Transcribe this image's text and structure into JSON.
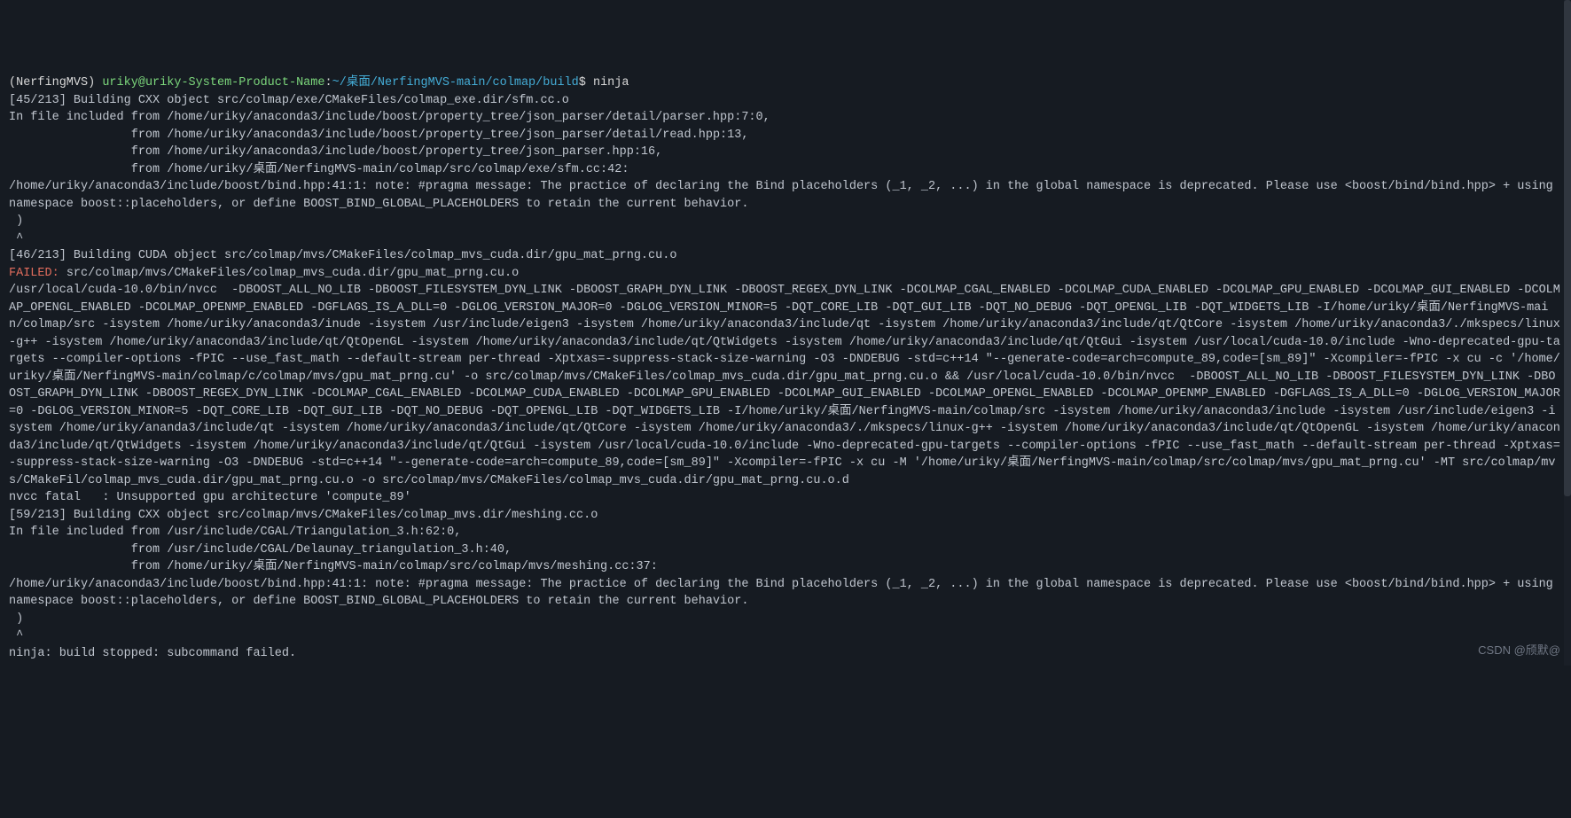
{
  "prompt": {
    "env": "(NerfingMVS)",
    "user": "uriky",
    "at": "@",
    "host": "uriky-System-Product-Name",
    "colon": ":",
    "tilde": "~",
    "path": "/桌面/NerfingMVS-main/colmap/build",
    "dollar": "$",
    "command": "ninja"
  },
  "lines": {
    "l01": "[45/213] Building CXX object src/colmap/exe/CMakeFiles/colmap_exe.dir/sfm.cc.o",
    "l02": "In file included from /home/uriky/anaconda3/include/boost/property_tree/json_parser/detail/parser.hpp:7:0,",
    "l03": "                 from /home/uriky/anaconda3/include/boost/property_tree/json_parser/detail/read.hpp:13,",
    "l04": "                 from /home/uriky/anaconda3/include/boost/property_tree/json_parser.hpp:16,",
    "l05": "                 from /home/uriky/桌面/NerfingMVS-main/colmap/src/colmap/exe/sfm.cc:42:",
    "l06": "/home/uriky/anaconda3/include/boost/bind.hpp:41:1: note: #pragma message: The practice of declaring the Bind placeholders (_1, _2, ...) in the global namespace is deprecated. Please use <boost/bind/bind.hpp> + using namespace boost::placeholders, or define BOOST_BIND_GLOBAL_PLACEHOLDERS to retain the current behavior.",
    "l07": " )",
    "l08": " ^",
    "l09": "[46/213] Building CUDA object src/colmap/mvs/CMakeFiles/colmap_mvs_cuda.dir/gpu_mat_prng.cu.o",
    "fail_label": "FAILED: ",
    "fail_rest": "src/colmap/mvs/CMakeFiles/colmap_mvs_cuda.dir/gpu_mat_prng.cu.o",
    "l11": "/usr/local/cuda-10.0/bin/nvcc  -DBOOST_ALL_NO_LIB -DBOOST_FILESYSTEM_DYN_LINK -DBOOST_GRAPH_DYN_LINK -DBOOST_REGEX_DYN_LINK -DCOLMAP_CGAL_ENABLED -DCOLMAP_CUDA_ENABLED -DCOLMAP_GPU_ENABLED -DCOLMAP_GUI_ENABLED -DCOLMAP_OPENGL_ENABLED -DCOLMAP_OPENMP_ENABLED -DGFLAGS_IS_A_DLL=0 -DGLOG_VERSION_MAJOR=0 -DGLOG_VERSION_MINOR=5 -DQT_CORE_LIB -DQT_GUI_LIB -DQT_NO_DEBUG -DQT_OPENGL_LIB -DQT_WIDGETS_LIB -I/home/uriky/桌面/NerfingMVS-main/colmap/src -isystem /home/uriky/anaconda3/inude -isystem /usr/include/eigen3 -isystem /home/uriky/anaconda3/include/qt -isystem /home/uriky/anaconda3/include/qt/QtCore -isystem /home/uriky/anaconda3/./mkspecs/linux-g++ -isystem /home/uriky/anaconda3/include/qt/QtOpenGL -isystem /home/uriky/anaconda3/include/qt/QtWidgets -isystem /home/uriky/anaconda3/include/qt/QtGui -isystem /usr/local/cuda-10.0/include -Wno-deprecated-gpu-targets --compiler-options -fPIC --use_fast_math --default-stream per-thread -Xptxas=-suppress-stack-size-warning -O3 -DNDEBUG -std=c++14 \"--generate-code=arch=compute_89,code=[sm_89]\" -Xcompiler=-fPIC -x cu -c '/home/uriky/桌面/NerfingMVS-main/colmap/c/colmap/mvs/gpu_mat_prng.cu' -o src/colmap/mvs/CMakeFiles/colmap_mvs_cuda.dir/gpu_mat_prng.cu.o && /usr/local/cuda-10.0/bin/nvcc  -DBOOST_ALL_NO_LIB -DBOOST_FILESYSTEM_DYN_LINK -DBOOST_GRAPH_DYN_LINK -DBOOST_REGEX_DYN_LINK -DCOLMAP_CGAL_ENABLED -DCOLMAP_CUDA_ENABLED -DCOLMAP_GPU_ENABLED -DCOLMAP_GUI_ENABLED -DCOLMAP_OPENGL_ENABLED -DCOLMAP_OPENMP_ENABLED -DGFLAGS_IS_A_DLL=0 -DGLOG_VERSION_MAJOR=0 -DGLOG_VERSION_MINOR=5 -DQT_CORE_LIB -DQT_GUI_LIB -DQT_NO_DEBUG -DQT_OPENGL_LIB -DQT_WIDGETS_LIB -I/home/uriky/桌面/NerfingMVS-main/colmap/src -isystem /home/uriky/anaconda3/include -isystem /usr/include/eigen3 -isystem /home/uriky/ananda3/include/qt -isystem /home/uriky/anaconda3/include/qt/QtCore -isystem /home/uriky/anaconda3/./mkspecs/linux-g++ -isystem /home/uriky/anaconda3/include/qt/QtOpenGL -isystem /home/uriky/anaconda3/include/qt/QtWidgets -isystem /home/uriky/anaconda3/include/qt/QtGui -isystem /usr/local/cuda-10.0/include -Wno-deprecated-gpu-targets --compiler-options -fPIC --use_fast_math --default-stream per-thread -Xptxas=-suppress-stack-size-warning -O3 -DNDEBUG -std=c++14 \"--generate-code=arch=compute_89,code=[sm_89]\" -Xcompiler=-fPIC -x cu -M '/home/uriky/桌面/NerfingMVS-main/colmap/src/colmap/mvs/gpu_mat_prng.cu' -MT src/colmap/mvs/CMakeFil/colmap_mvs_cuda.dir/gpu_mat_prng.cu.o -o src/colmap/mvs/CMakeFiles/colmap_mvs_cuda.dir/gpu_mat_prng.cu.o.d",
    "l12": "nvcc fatal   : Unsupported gpu architecture 'compute_89'",
    "l13": "[59/213] Building CXX object src/colmap/mvs/CMakeFiles/colmap_mvs.dir/meshing.cc.o",
    "l14": "In file included from /usr/include/CGAL/Triangulation_3.h:62:0,",
    "l15": "                 from /usr/include/CGAL/Delaunay_triangulation_3.h:40,",
    "l16": "                 from /home/uriky/桌面/NerfingMVS-main/colmap/src/colmap/mvs/meshing.cc:37:",
    "l17": "/home/uriky/anaconda3/include/boost/bind.hpp:41:1: note: #pragma message: The practice of declaring the Bind placeholders (_1, _2, ...) in the global namespace is deprecated. Please use <boost/bind/bind.hpp> + using namespace boost::placeholders, or define BOOST_BIND_GLOBAL_PLACEHOLDERS to retain the current behavior.",
    "l18": " )",
    "l19": " ^",
    "l20": "ninja: build stopped: subcommand failed."
  },
  "watermark": "CSDN @颀默@"
}
